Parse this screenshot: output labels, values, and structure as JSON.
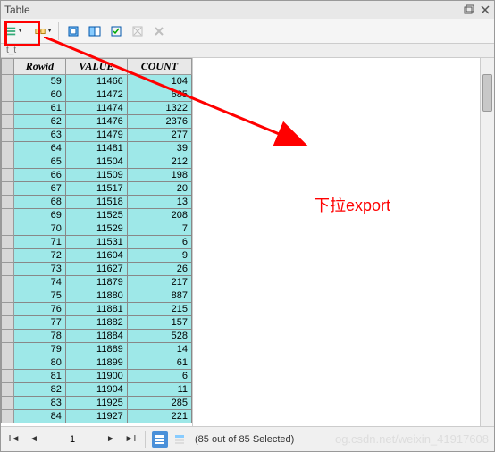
{
  "title": "Table",
  "layer_label": "t_t",
  "annotation": "下拉export",
  "watermark": "og.csdn.net/weixin_41917608",
  "columns": [
    "Rowid",
    "VALUE",
    "COUNT"
  ],
  "rows": [
    {
      "rowid": 59,
      "value": 11466,
      "count": 104
    },
    {
      "rowid": 60,
      "value": 11472,
      "count": 685
    },
    {
      "rowid": 61,
      "value": 11474,
      "count": 1322
    },
    {
      "rowid": 62,
      "value": 11476,
      "count": 2376
    },
    {
      "rowid": 63,
      "value": 11479,
      "count": 277
    },
    {
      "rowid": 64,
      "value": 11481,
      "count": 39
    },
    {
      "rowid": 65,
      "value": 11504,
      "count": 212
    },
    {
      "rowid": 66,
      "value": 11509,
      "count": 198
    },
    {
      "rowid": 67,
      "value": 11517,
      "count": 20
    },
    {
      "rowid": 68,
      "value": 11518,
      "count": 13
    },
    {
      "rowid": 69,
      "value": 11525,
      "count": 208
    },
    {
      "rowid": 70,
      "value": 11529,
      "count": 7
    },
    {
      "rowid": 71,
      "value": 11531,
      "count": 6
    },
    {
      "rowid": 72,
      "value": 11604,
      "count": 9
    },
    {
      "rowid": 73,
      "value": 11627,
      "count": 26
    },
    {
      "rowid": 74,
      "value": 11879,
      "count": 217
    },
    {
      "rowid": 75,
      "value": 11880,
      "count": 887
    },
    {
      "rowid": 76,
      "value": 11881,
      "count": 215
    },
    {
      "rowid": 77,
      "value": 11882,
      "count": 157
    },
    {
      "rowid": 78,
      "value": 11884,
      "count": 528
    },
    {
      "rowid": 79,
      "value": 11889,
      "count": 14
    },
    {
      "rowid": 80,
      "value": 11899,
      "count": 61
    },
    {
      "rowid": 81,
      "value": 11900,
      "count": 6
    },
    {
      "rowid": 82,
      "value": 11904,
      "count": 11
    },
    {
      "rowid": 83,
      "value": 11925,
      "count": 285
    },
    {
      "rowid": 84,
      "value": 11927,
      "count": 221
    }
  ],
  "nav": {
    "page": "1",
    "status": "(85 out of 85 Selected)"
  },
  "icons": {
    "list": "list-icon",
    "db": "db-icon",
    "related1": "related-tables-icon",
    "related2": "related-data-icon",
    "select": "select-by-attributes-icon",
    "switch": "switch-selection-icon",
    "clear": "clear-selection-icon"
  }
}
